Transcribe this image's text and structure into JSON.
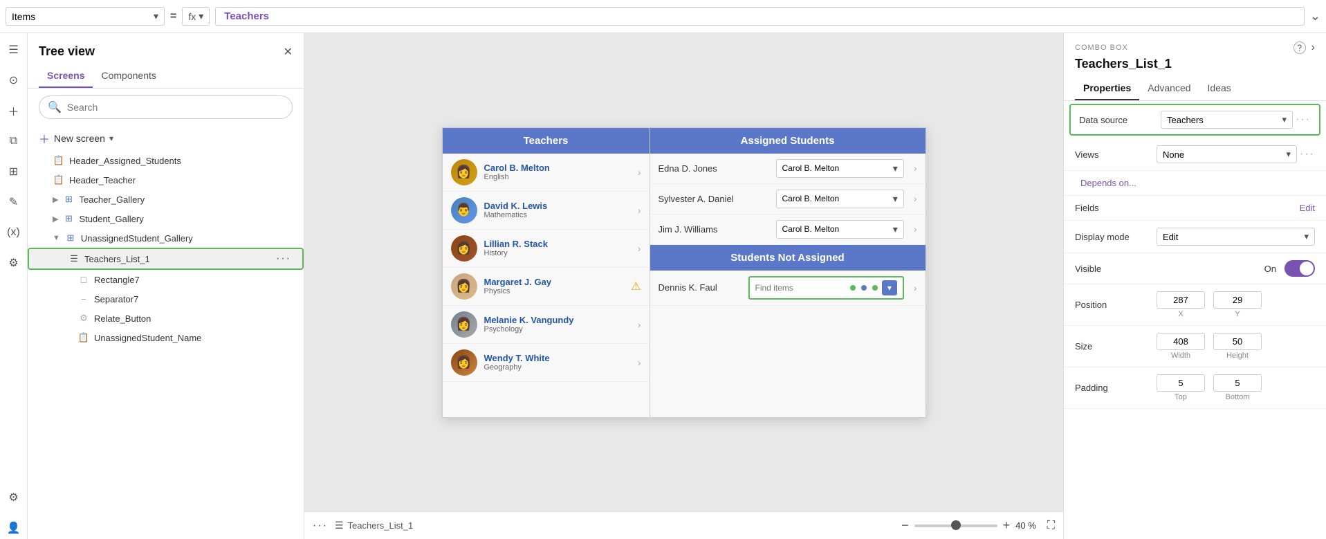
{
  "topbar": {
    "items_label": "Items",
    "equals_symbol": "=",
    "fx_label": "fx",
    "formula_value": "Teachers",
    "chevron_symbol": "⌄"
  },
  "sidebar": {
    "title": "Tree view",
    "close_icon": "✕",
    "tabs": [
      {
        "label": "Screens",
        "active": true
      },
      {
        "label": "Components",
        "active": false
      }
    ],
    "search_placeholder": "Search",
    "new_screen_label": "New screen",
    "items": [
      {
        "label": "Header_Assigned_Students",
        "indent": 1,
        "icon": "📋",
        "has_chevron": false
      },
      {
        "label": "Header_Teacher",
        "indent": 1,
        "icon": "📋",
        "has_chevron": false
      },
      {
        "label": "Teacher_Gallery",
        "indent": 1,
        "icon": "⊞",
        "has_chevron": true
      },
      {
        "label": "Student_Gallery",
        "indent": 1,
        "icon": "⊞",
        "has_chevron": true
      },
      {
        "label": "UnassignedStudent_Gallery",
        "indent": 1,
        "icon": "⊞",
        "has_chevron": false
      },
      {
        "label": "Teachers_List_1",
        "indent": 2,
        "icon": "☰",
        "has_chevron": false,
        "selected": true
      },
      {
        "label": "Rectangle7",
        "indent": 3,
        "icon": "◻",
        "has_chevron": false
      },
      {
        "label": "Separator7",
        "indent": 3,
        "icon": "⎯",
        "has_chevron": false
      },
      {
        "label": "Relate_Button",
        "indent": 3,
        "icon": "⚙",
        "has_chevron": false
      },
      {
        "label": "UnassignedStudent_Name",
        "indent": 3,
        "icon": "📋",
        "has_chevron": false
      }
    ]
  },
  "canvas": {
    "teachers_header": "Teachers",
    "assigned_header": "Assigned Students",
    "not_assigned_header": "Students Not Assigned",
    "teachers": [
      {
        "name": "Carol B. Melton",
        "subject": "English"
      },
      {
        "name": "David K. Lewis",
        "subject": "Mathematics"
      },
      {
        "name": "Lillian R. Stack",
        "subject": "History"
      },
      {
        "name": "Margaret J. Gay",
        "subject": "Physics"
      },
      {
        "name": "Melanie K. Vangundy",
        "subject": "Psychology"
      },
      {
        "name": "Wendy T. White",
        "subject": "Geography"
      }
    ],
    "assigned_students": [
      {
        "name": "Edna D. Jones",
        "assigned_to": "Carol B. Melton"
      },
      {
        "name": "Sylvester A. Daniel",
        "assigned_to": "Carol B. Melton"
      },
      {
        "name": "Jim J. Williams",
        "assigned_to": "Carol B. Melton"
      }
    ],
    "not_assigned_students": [
      {
        "name": "Dennis K. Faul",
        "combo_placeholder": "Find items"
      }
    ],
    "bottom_name": "Teachers_List_1",
    "zoom_minus": "−",
    "zoom_plus": "+",
    "zoom_pct": "40 %"
  },
  "properties": {
    "type_label": "COMBO BOX",
    "help_symbol": "?",
    "chevron_symbol": "›",
    "component_name": "Teachers_List_1",
    "tabs": [
      {
        "label": "Properties",
        "active": true
      },
      {
        "label": "Advanced",
        "active": false
      },
      {
        "label": "Ideas",
        "active": false
      }
    ],
    "data_source_label": "Data source",
    "data_source_value": "Teachers",
    "views_label": "Views",
    "views_value": "None",
    "depends_on_label": "Depends on...",
    "fields_label": "Fields",
    "fields_edit": "Edit",
    "display_mode_label": "Display mode",
    "display_mode_value": "Edit",
    "visible_label": "Visible",
    "visible_value": "On",
    "position_label": "Position",
    "position_x": "287",
    "position_x_label": "X",
    "position_y": "29",
    "position_y_label": "Y",
    "size_label": "Size",
    "size_width": "408",
    "size_width_label": "Width",
    "size_height": "50",
    "size_height_label": "Height",
    "padding_label": "Padding",
    "padding_top": "5",
    "padding_top_label": "Top",
    "padding_bottom": "5",
    "padding_bottom_label": "Bottom",
    "padding_note": "5",
    "more_dots": "···"
  }
}
